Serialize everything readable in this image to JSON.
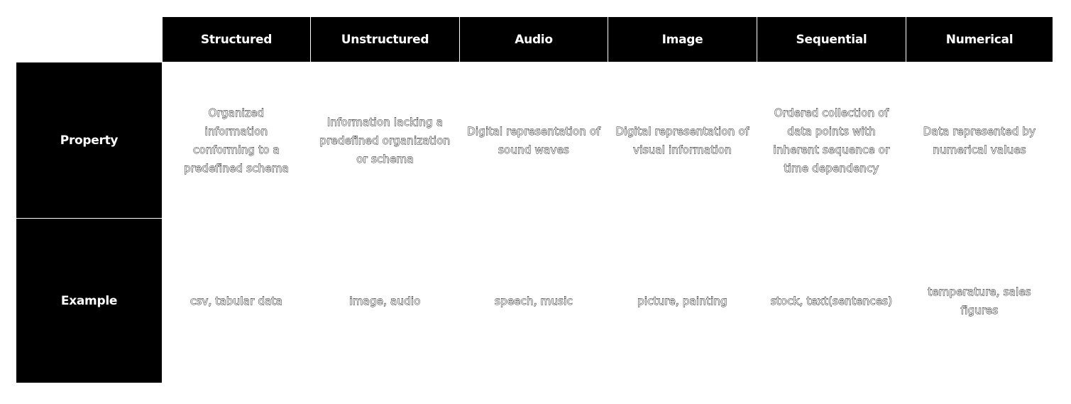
{
  "table": {
    "columns": [
      "Structured",
      "Unstructured",
      "Audio",
      "Image",
      "Sequential",
      "Numerical"
    ],
    "rows": [
      {
        "label": "Property",
        "cells": [
          "Organized information conforming to a predefined schema",
          "Information lacking a predefined organization or schema",
          "Digital representation of sound waves",
          "Digital representation of visual information",
          "Ordered collection of data points with inherent sequence or time dependency",
          "Data represented by numerical values"
        ]
      },
      {
        "label": "Example",
        "cells": [
          "csv, tabular data",
          "image, audio",
          "speech, music",
          "picture, painting",
          "stock, text(sentences)",
          "temperature, sales figures"
        ]
      }
    ]
  },
  "colors": {
    "header_background": "#000000",
    "header_text": "#ffffff",
    "page_background": "#ffffff"
  }
}
